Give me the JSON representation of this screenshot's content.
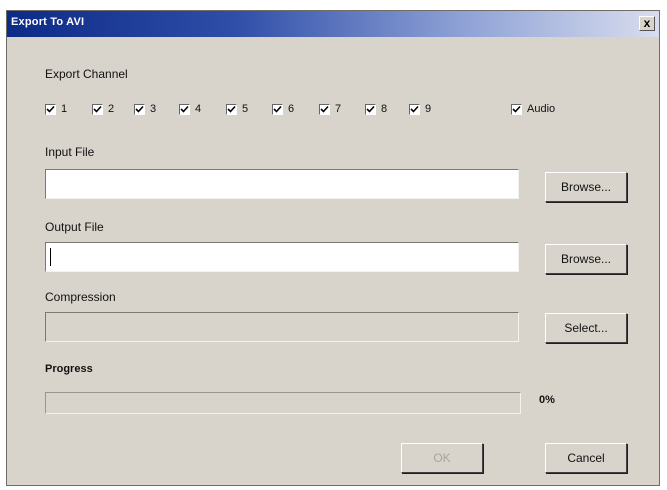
{
  "dialog": {
    "title": "Export To AVI",
    "close_label": "x"
  },
  "export_channel": {
    "label": "Export Channel",
    "channels": [
      {
        "label": "1",
        "checked": true
      },
      {
        "label": "2",
        "checked": true
      },
      {
        "label": "3",
        "checked": true
      },
      {
        "label": "4",
        "checked": true
      },
      {
        "label": "5",
        "checked": true
      },
      {
        "label": "6",
        "checked": true
      },
      {
        "label": "7",
        "checked": true
      },
      {
        "label": "8",
        "checked": true
      },
      {
        "label": "9",
        "checked": true
      }
    ],
    "audio": {
      "label": "Audio",
      "checked": true
    }
  },
  "input_file": {
    "label": "Input File",
    "value": "",
    "browse_label": "Browse..."
  },
  "output_file": {
    "label": "Output File",
    "value": "",
    "browse_label": "Browse..."
  },
  "compression": {
    "label": "Compression",
    "value": "",
    "select_label": "Select..."
  },
  "progress": {
    "label": "Progress",
    "value_text": "0%",
    "fraction": 0
  },
  "buttons": {
    "ok_label": "OK",
    "cancel_label": "Cancel"
  },
  "colors": {
    "title_bar": "#0c2a87",
    "dialog_bg": "#d8d4cc"
  }
}
